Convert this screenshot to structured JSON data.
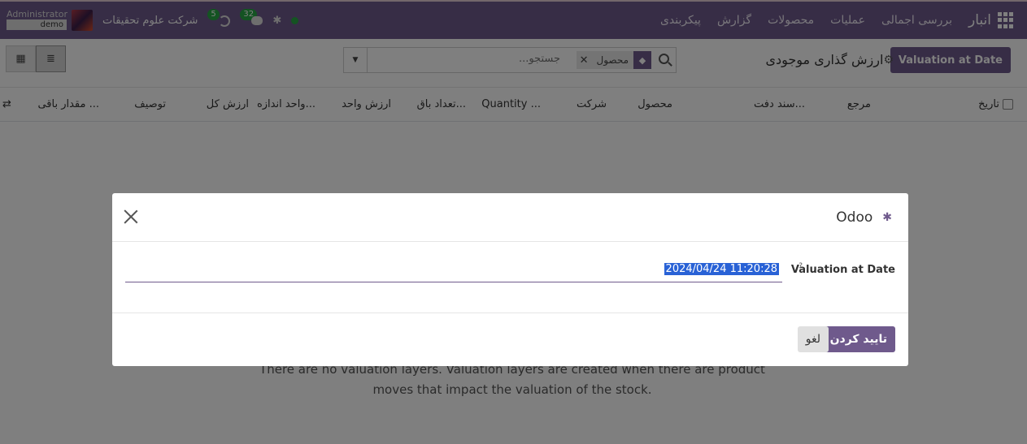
{
  "navbar": {
    "brand": "انبار",
    "menus": [
      "بررسی اجمالی",
      "عملیات",
      "محصولات",
      "گزارش",
      "پیکربندی"
    ],
    "company": "شرکت علوم تحقیقات",
    "user_name": "Administrator",
    "database": "demo",
    "messages_count": "32",
    "activities_count": "5"
  },
  "control": {
    "action_button": "Valuation at Date",
    "breadcrumb": "ارزش گذاری موجودی",
    "search_placeholder": "جستجو...",
    "facet_label": "محصول"
  },
  "list": {
    "columns": [
      "تاریخ",
      "مرجع",
      "سند دفت...",
      "محصول",
      "شرکت",
      "Quantity ...",
      "تعداد باق...",
      "ارزش واحد",
      "واحد اندازه...",
      "ارزش کل",
      "توصیف",
      "مقدار باقی ..."
    ],
    "empty_line1": "There are no valuation layers. Valuation layers are created when there are product",
    "empty_line2": "moves that impact the valuation of the stock."
  },
  "modal": {
    "title": "Odoo",
    "field_label": "Valuation at Date",
    "help": "?",
    "field_value": "2024/04/24 11:20:28",
    "confirm_label": "تایید کردن",
    "cancel_label": "لغو"
  }
}
